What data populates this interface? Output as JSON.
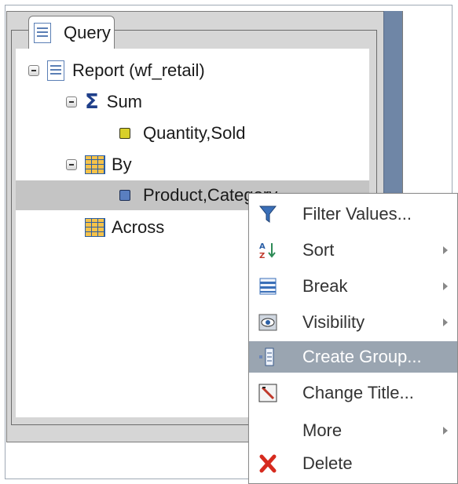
{
  "panel": {
    "tab_label": "Query"
  },
  "tree": {
    "report_label": "Report (wf_retail)",
    "sum_label": "Sum",
    "sum_field": "Quantity,Sold",
    "by_label": "By",
    "by_field": "Product,Category",
    "across_label": "Across"
  },
  "context_menu": {
    "items": [
      {
        "label": "Filter Values...",
        "icon": "filter-icon",
        "submenu": false
      },
      {
        "label": "Sort",
        "icon": "sort-icon",
        "submenu": true
      },
      {
        "label": "Break",
        "icon": "break-icon",
        "submenu": true
      },
      {
        "label": "Visibility",
        "icon": "visibility-icon",
        "submenu": true
      },
      {
        "label": "Create Group...",
        "icon": "create-group-icon",
        "submenu": false,
        "highlighted": true
      },
      {
        "label": "Change Title...",
        "icon": "change-title-icon",
        "submenu": false
      },
      {
        "label": "More",
        "icon": "",
        "submenu": true
      },
      {
        "label": "Delete",
        "icon": "delete-icon",
        "submenu": false
      }
    ]
  },
  "colors": {
    "selection": "#c4c4c4",
    "menu_highlight": "#9aa5b1",
    "panel_bar": "#6f86a6"
  }
}
